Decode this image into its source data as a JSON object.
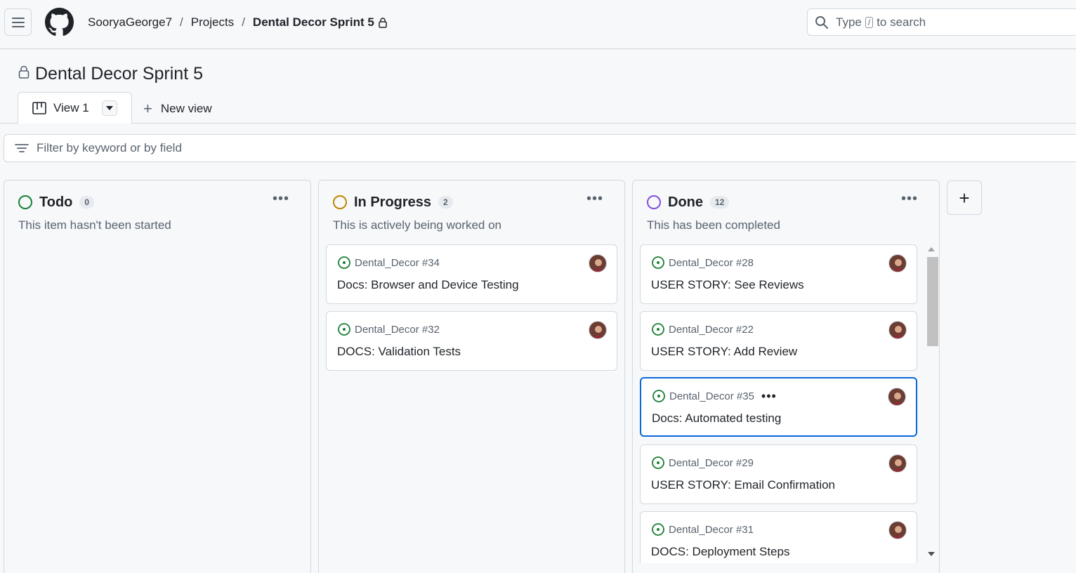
{
  "header": {
    "breadcrumb": {
      "owner": "SooryaGeorge7",
      "section": "Projects",
      "project": "Dental Decor Sprint 5"
    },
    "search": {
      "prefix": "Type",
      "shortcut": "/",
      "suffix": "to search"
    }
  },
  "project": {
    "title": "Dental Decor Sprint 5"
  },
  "tabs": {
    "view_label": "View 1",
    "new_view_label": "New view"
  },
  "filter": {
    "placeholder": "Filter by keyword or by field"
  },
  "columns": [
    {
      "name": "Todo",
      "count": "0",
      "description": "This item hasn't been started",
      "status_color": "#1a7f37",
      "cards": []
    },
    {
      "name": "In Progress",
      "count": "2",
      "description": "This is actively being worked on",
      "status_color": "#bf8700",
      "cards": [
        {
          "repo_ref": "Dental_Decor #34",
          "title": "Docs: Browser and Device Testing"
        },
        {
          "repo_ref": "Dental_Decor #32",
          "title": "DOCS: Validation Tests"
        }
      ]
    },
    {
      "name": "Done",
      "count": "12",
      "description": "This has been completed",
      "status_color": "#8250df",
      "cards": [
        {
          "repo_ref": "Dental_Decor #28",
          "title": "USER STORY: See Reviews"
        },
        {
          "repo_ref": "Dental_Decor #22",
          "title": "USER STORY: Add Review"
        },
        {
          "repo_ref": "Dental_Decor #35",
          "title": "Docs: Automated testing",
          "focused": true
        },
        {
          "repo_ref": "Dental_Decor #29",
          "title": "USER STORY: Email Confirmation"
        },
        {
          "repo_ref": "Dental_Decor #31",
          "title": "DOCS: Deployment Steps"
        }
      ]
    }
  ],
  "colors": {
    "open_issue": "#1a7f37",
    "focus_border": "#0969da",
    "border": "#d1d9e0",
    "muted_text": "#59636e"
  },
  "icons": {
    "menu": "hamburger-menu-icon",
    "logo": "github-octocat-icon",
    "lock": "lock-icon",
    "search": "search-icon",
    "board": "board-view-icon",
    "filter": "filter-icon",
    "issue": "issue-opened-icon",
    "more": "kebab-horizontal-icon",
    "add": "plus-icon"
  }
}
